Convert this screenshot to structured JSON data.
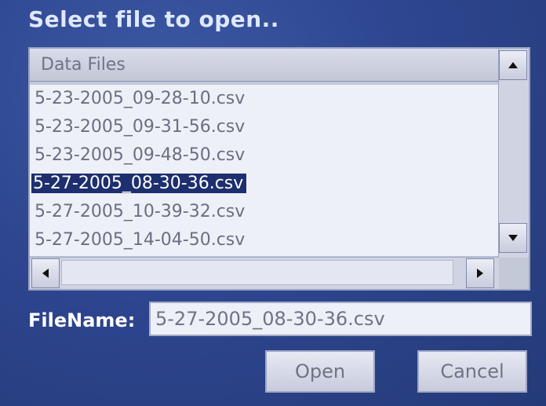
{
  "dialog": {
    "title": "Select file to open.."
  },
  "list": {
    "header": "Data Files",
    "files": [
      "5-23-2005_09-28-10.csv",
      "5-23-2005_09-31-56.csv",
      "5-23-2005_09-48-50.csv",
      "5-27-2005_08-30-36.csv",
      "5-27-2005_10-39-32.csv",
      "5-27-2005_14-04-50.csv"
    ],
    "selected_file": "5-27-2005_08-30-36.csv"
  },
  "icons": {
    "up": "scroll-up-arrow-icon",
    "down": "scroll-down-arrow-icon",
    "left": "scroll-left-arrow-icon",
    "right": "scroll-right-arrow-icon"
  },
  "filename": {
    "label": "FileName:",
    "value": "5-27-2005_08-30-36.csv"
  },
  "buttons": {
    "open": "Open",
    "cancel": "Cancel"
  },
  "colors": {
    "selection": "#1d2f6e",
    "background": "#2e4690"
  }
}
